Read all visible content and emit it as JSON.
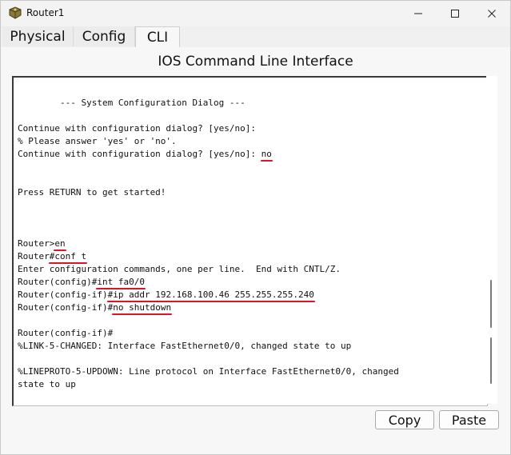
{
  "window": {
    "title": "Router1",
    "minimize_glyph": "—",
    "maximize_glyph": "☐",
    "close_glyph": "✕"
  },
  "tabs": [
    {
      "label": "Physical"
    },
    {
      "label": "Config"
    },
    {
      "label": "CLI"
    }
  ],
  "heading": "IOS Command Line Interface",
  "terminal": {
    "lines": [
      "        --- System Configuration Dialog ---",
      "",
      "Continue with configuration dialog? [yes/no]:",
      "% Please answer 'yes' or 'no'.",
      "Continue with configuration dialog? [yes/no]: no",
      "",
      "",
      "Press RETURN to get started!",
      "",
      "",
      "",
      "Router>en",
      "Router#conf t",
      "Enter configuration commands, one per line.  End with CNTL/Z.",
      "Router(config)#int fa0/0",
      "Router(config-if)#ip addr 192.168.100.46 255.255.255.240",
      "Router(config-if)#no shutdown",
      "",
      "Router(config-if)#",
      "%LINK-5-CHANGED: Interface FastEthernet0/0, changed state to up",
      "",
      "%LINEPROTO-5-UPDOWN: Line protocol on Interface FastEthernet0/0, changed",
      "state to up"
    ],
    "highlighted": [
      {
        "line": 4,
        "prefix": "Continue with configuration dialog? [yes/no]: ",
        "mark": "no"
      },
      {
        "line": 11,
        "prefix": "Router>",
        "mark": "en"
      },
      {
        "line": 12,
        "prefix": "Router",
        "mark": "#conf t"
      },
      {
        "line": 14,
        "prefix": "Router(config)#",
        "mark": "int fa0/0"
      },
      {
        "line": 15,
        "prefix": "Router(config-if)",
        "mark": "#ip addr 192.168.100.46 255.255.255.240"
      },
      {
        "line": 16,
        "prefix": "Router(config-if)#",
        "mark": "no shutdown"
      }
    ],
    "annotation_color": "#e0112b"
  },
  "buttons": {
    "copy": "Copy",
    "paste": "Paste"
  }
}
